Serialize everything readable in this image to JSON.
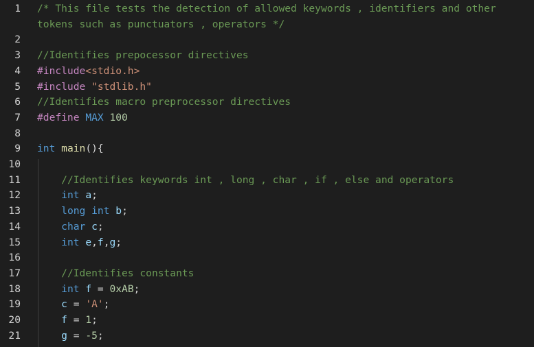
{
  "editor": {
    "lines": [
      {
        "number": "1",
        "tokens": [
          {
            "text": "/* This file tests the detection of allowed keywords , identifiers and other",
            "class": "t-comment"
          }
        ]
      },
      {
        "number": "",
        "tokens": [
          {
            "text": "tokens such as punctuators , operators */",
            "class": "t-comment"
          }
        ]
      },
      {
        "number": "2",
        "tokens": []
      },
      {
        "number": "3",
        "tokens": [
          {
            "text": "//Identifies prepocessor directives",
            "class": "t-comment"
          }
        ]
      },
      {
        "number": "4",
        "tokens": [
          {
            "text": "#include",
            "class": "t-directive"
          },
          {
            "text": "<stdio.h>",
            "class": "t-string"
          }
        ]
      },
      {
        "number": "5",
        "tokens": [
          {
            "text": "#include",
            "class": "t-directive"
          },
          {
            "text": " ",
            "class": "t-punct"
          },
          {
            "text": "\"stdlib.h\"",
            "class": "t-string"
          }
        ]
      },
      {
        "number": "6",
        "tokens": [
          {
            "text": "//Identifies macro preprocessor directives",
            "class": "t-comment"
          }
        ]
      },
      {
        "number": "7",
        "tokens": [
          {
            "text": "#define",
            "class": "t-directive"
          },
          {
            "text": " ",
            "class": "t-punct"
          },
          {
            "text": "MAX",
            "class": "t-macro"
          },
          {
            "text": " ",
            "class": "t-punct"
          },
          {
            "text": "100",
            "class": "t-number"
          }
        ]
      },
      {
        "number": "8",
        "tokens": []
      },
      {
        "number": "9",
        "tokens": [
          {
            "text": "int",
            "class": "t-keyword"
          },
          {
            "text": " ",
            "class": "t-punct"
          },
          {
            "text": "main",
            "class": "t-func"
          },
          {
            "text": "(){",
            "class": "t-punct"
          }
        ]
      },
      {
        "number": "10",
        "tokens": []
      },
      {
        "number": "11",
        "tokens": [
          {
            "text": "    ",
            "class": "t-punct"
          },
          {
            "text": "//Identifies keywords int , long , char , if , else and operators",
            "class": "t-comment"
          }
        ]
      },
      {
        "number": "12",
        "tokens": [
          {
            "text": "    ",
            "class": "t-punct"
          },
          {
            "text": "int",
            "class": "t-keyword"
          },
          {
            "text": " ",
            "class": "t-punct"
          },
          {
            "text": "a",
            "class": "t-ident"
          },
          {
            "text": ";",
            "class": "t-punct"
          }
        ]
      },
      {
        "number": "13",
        "tokens": [
          {
            "text": "    ",
            "class": "t-punct"
          },
          {
            "text": "long",
            "class": "t-keyword"
          },
          {
            "text": " ",
            "class": "t-punct"
          },
          {
            "text": "int",
            "class": "t-keyword"
          },
          {
            "text": " ",
            "class": "t-punct"
          },
          {
            "text": "b",
            "class": "t-ident"
          },
          {
            "text": ";",
            "class": "t-punct"
          }
        ]
      },
      {
        "number": "14",
        "tokens": [
          {
            "text": "    ",
            "class": "t-punct"
          },
          {
            "text": "char",
            "class": "t-keyword"
          },
          {
            "text": " ",
            "class": "t-punct"
          },
          {
            "text": "c",
            "class": "t-ident"
          },
          {
            "text": ";",
            "class": "t-punct"
          }
        ]
      },
      {
        "number": "15",
        "tokens": [
          {
            "text": "    ",
            "class": "t-punct"
          },
          {
            "text": "int",
            "class": "t-keyword"
          },
          {
            "text": " ",
            "class": "t-punct"
          },
          {
            "text": "e",
            "class": "t-ident"
          },
          {
            "text": ",",
            "class": "t-punct"
          },
          {
            "text": "f",
            "class": "t-ident"
          },
          {
            "text": ",",
            "class": "t-punct"
          },
          {
            "text": "g",
            "class": "t-ident"
          },
          {
            "text": ";",
            "class": "t-punct"
          }
        ]
      },
      {
        "number": "16",
        "tokens": []
      },
      {
        "number": "17",
        "tokens": [
          {
            "text": "    ",
            "class": "t-punct"
          },
          {
            "text": "//Identifies constants",
            "class": "t-comment"
          }
        ]
      },
      {
        "number": "18",
        "tokens": [
          {
            "text": "    ",
            "class": "t-punct"
          },
          {
            "text": "int",
            "class": "t-keyword"
          },
          {
            "text": " ",
            "class": "t-punct"
          },
          {
            "text": "f",
            "class": "t-ident"
          },
          {
            "text": " = ",
            "class": "t-punct"
          },
          {
            "text": "0xAB",
            "class": "t-number"
          },
          {
            "text": ";",
            "class": "t-punct"
          }
        ]
      },
      {
        "number": "19",
        "tokens": [
          {
            "text": "    ",
            "class": "t-punct"
          },
          {
            "text": "c",
            "class": "t-ident"
          },
          {
            "text": " = ",
            "class": "t-punct"
          },
          {
            "text": "'A'",
            "class": "t-string"
          },
          {
            "text": ";",
            "class": "t-punct"
          }
        ]
      },
      {
        "number": "20",
        "tokens": [
          {
            "text": "    ",
            "class": "t-punct"
          },
          {
            "text": "f",
            "class": "t-ident"
          },
          {
            "text": " = ",
            "class": "t-punct"
          },
          {
            "text": "1",
            "class": "t-number"
          },
          {
            "text": ";",
            "class": "t-punct"
          }
        ]
      },
      {
        "number": "21",
        "tokens": [
          {
            "text": "    ",
            "class": "t-punct"
          },
          {
            "text": "g",
            "class": "t-ident"
          },
          {
            "text": " = ",
            "class": "t-punct"
          },
          {
            "text": "-5",
            "class": "t-number"
          },
          {
            "text": ";",
            "class": "t-punct"
          }
        ]
      }
    ]
  },
  "colors": {
    "background": "#1e1e1e",
    "comment": "#6a9955",
    "directive": "#c586c0",
    "string": "#ce9178",
    "keyword": "#569cd6",
    "function": "#dcdcaa",
    "identifier": "#9cdcfe",
    "number": "#b5cea8",
    "text": "#d4d4d4"
  }
}
